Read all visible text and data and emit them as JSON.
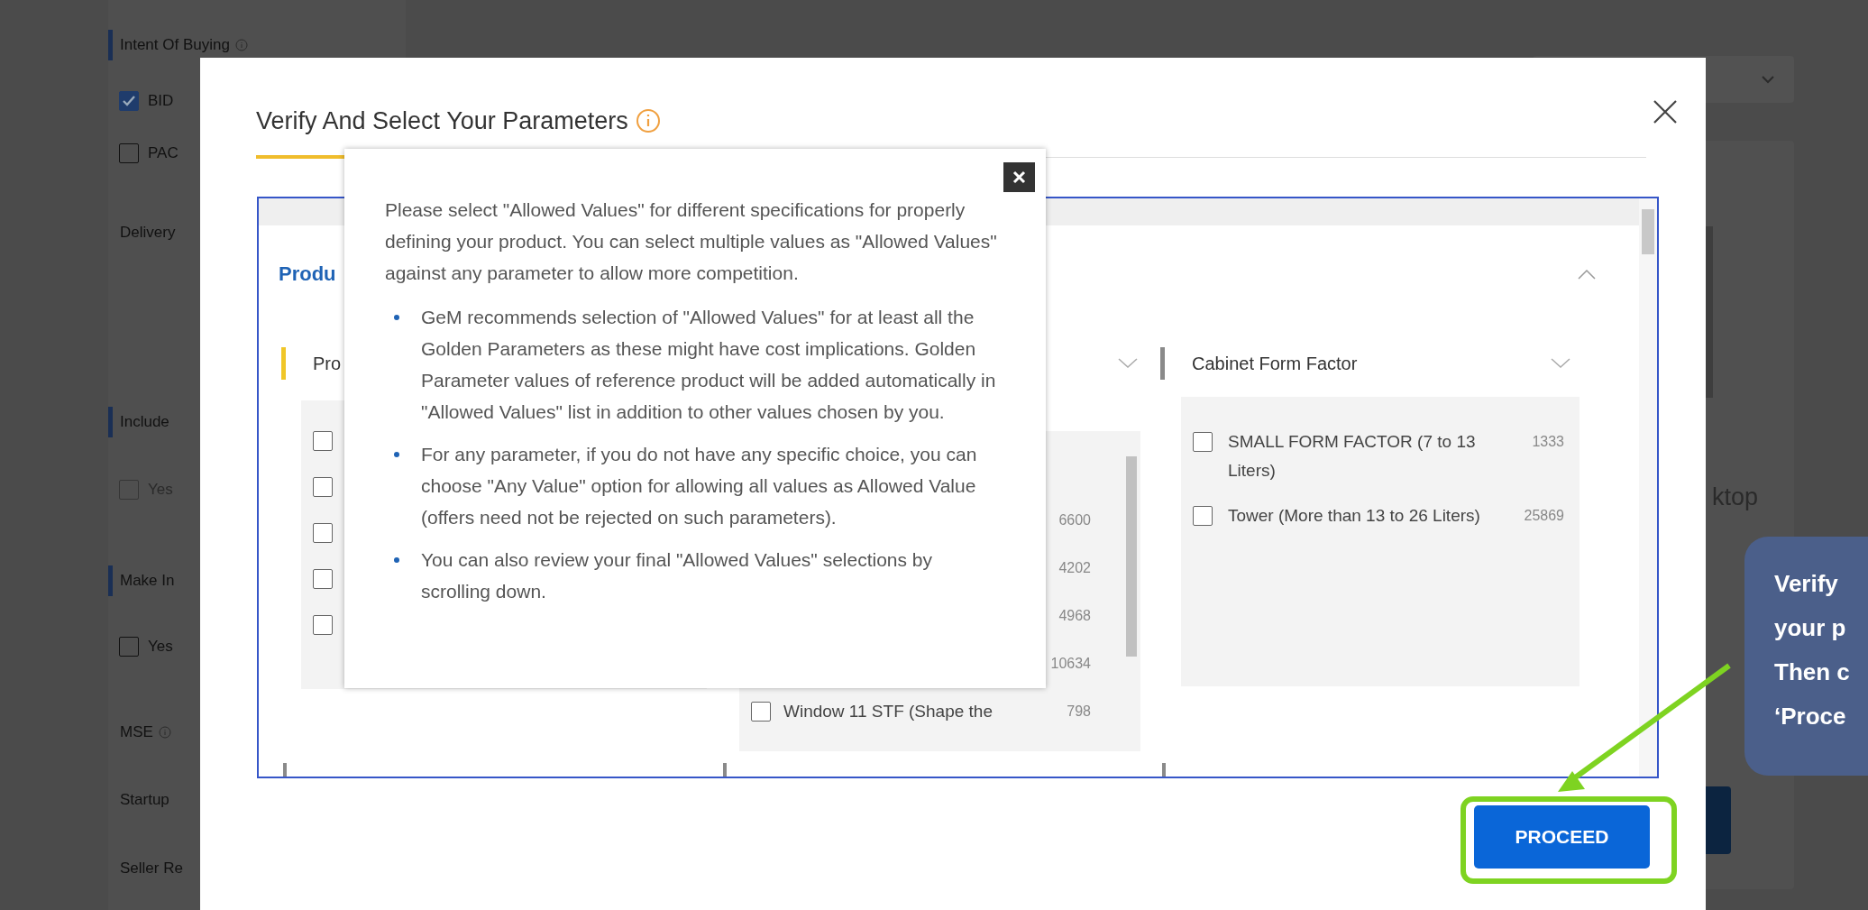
{
  "background": {
    "sidebar": [
      {
        "kind": "heading",
        "label": "Intent Of Buying",
        "info_icon": true
      },
      {
        "kind": "checkbox",
        "label": "BID",
        "checked": true,
        "disabled": false
      },
      {
        "kind": "checkbox",
        "label": "PAC",
        "checked": false,
        "disabled": false
      },
      {
        "kind": "label",
        "label": "Delivery",
        "info_icon": false
      },
      {
        "kind": "heading",
        "label": "Include",
        "info_icon": false
      },
      {
        "kind": "checkbox",
        "label": "Yes",
        "checked": false,
        "disabled": true
      },
      {
        "kind": "heading",
        "label": "Make In",
        "info_icon": false
      },
      {
        "kind": "checkbox",
        "label": "Yes",
        "checked": false,
        "disabled": false
      },
      {
        "kind": "label",
        "label": "MSE",
        "info_icon": true
      },
      {
        "kind": "label",
        "label": "Startup",
        "info_icon": false
      },
      {
        "kind": "label",
        "label": "Seller Re",
        "info_icon": false
      }
    ],
    "product_card": {
      "title": "ktop"
    }
  },
  "modal": {
    "title": "Verify And Select Your Parameters",
    "section_title": "Produ",
    "columns": [
      {
        "header": "Pro",
        "golden": true,
        "options": [
          {
            "checked": false
          },
          {
            "checked": false
          },
          {
            "checked": false
          },
          {
            "checked": false
          },
          {
            "checked": false
          }
        ]
      },
      {
        "options": [
          {
            "count": "6600"
          },
          {
            "count": "4202"
          },
          {
            "count": "4968"
          },
          {
            "count": "10634"
          },
          {
            "label": "Window 11 STF (Shape the",
            "count": "798",
            "checked": false
          }
        ]
      },
      {
        "header": "Cabinet Form Factor",
        "golden": false,
        "options": [
          {
            "label": "SMALL FORM FACTOR (7 to 13 Liters)",
            "count": "1333",
            "checked": false
          },
          {
            "label": "Tower (More than 13 to 26 Liters)",
            "count": "25869",
            "checked": false
          }
        ]
      }
    ],
    "proceed_button": "PROCEED"
  },
  "tooltip": {
    "intro": "Please select \"Allowed Values\" for different specifications for properly defining your product. You can select multiple values as \"Allowed Values\" against any parameter to allow more competition.",
    "bullets": [
      "GeM recommends selection of \"Allowed Values\" for at least all the Golden Parameters as these might have cost implications. Golden Parameter values of reference product will be added automatically in \"Allowed Values\" list in addition to other values chosen by you.",
      "For any parameter, if you do not have any specific choice, you can choose \"Any Value\" option for allowing all values as Allowed Value (offers need not be rejected on such parameters).",
      "You can also review your final \"Allowed Values\" selections by scrolling down."
    ]
  },
  "callout": {
    "lines": [
      "Verify",
      "your p",
      "Then c",
      "‘Proce"
    ]
  }
}
